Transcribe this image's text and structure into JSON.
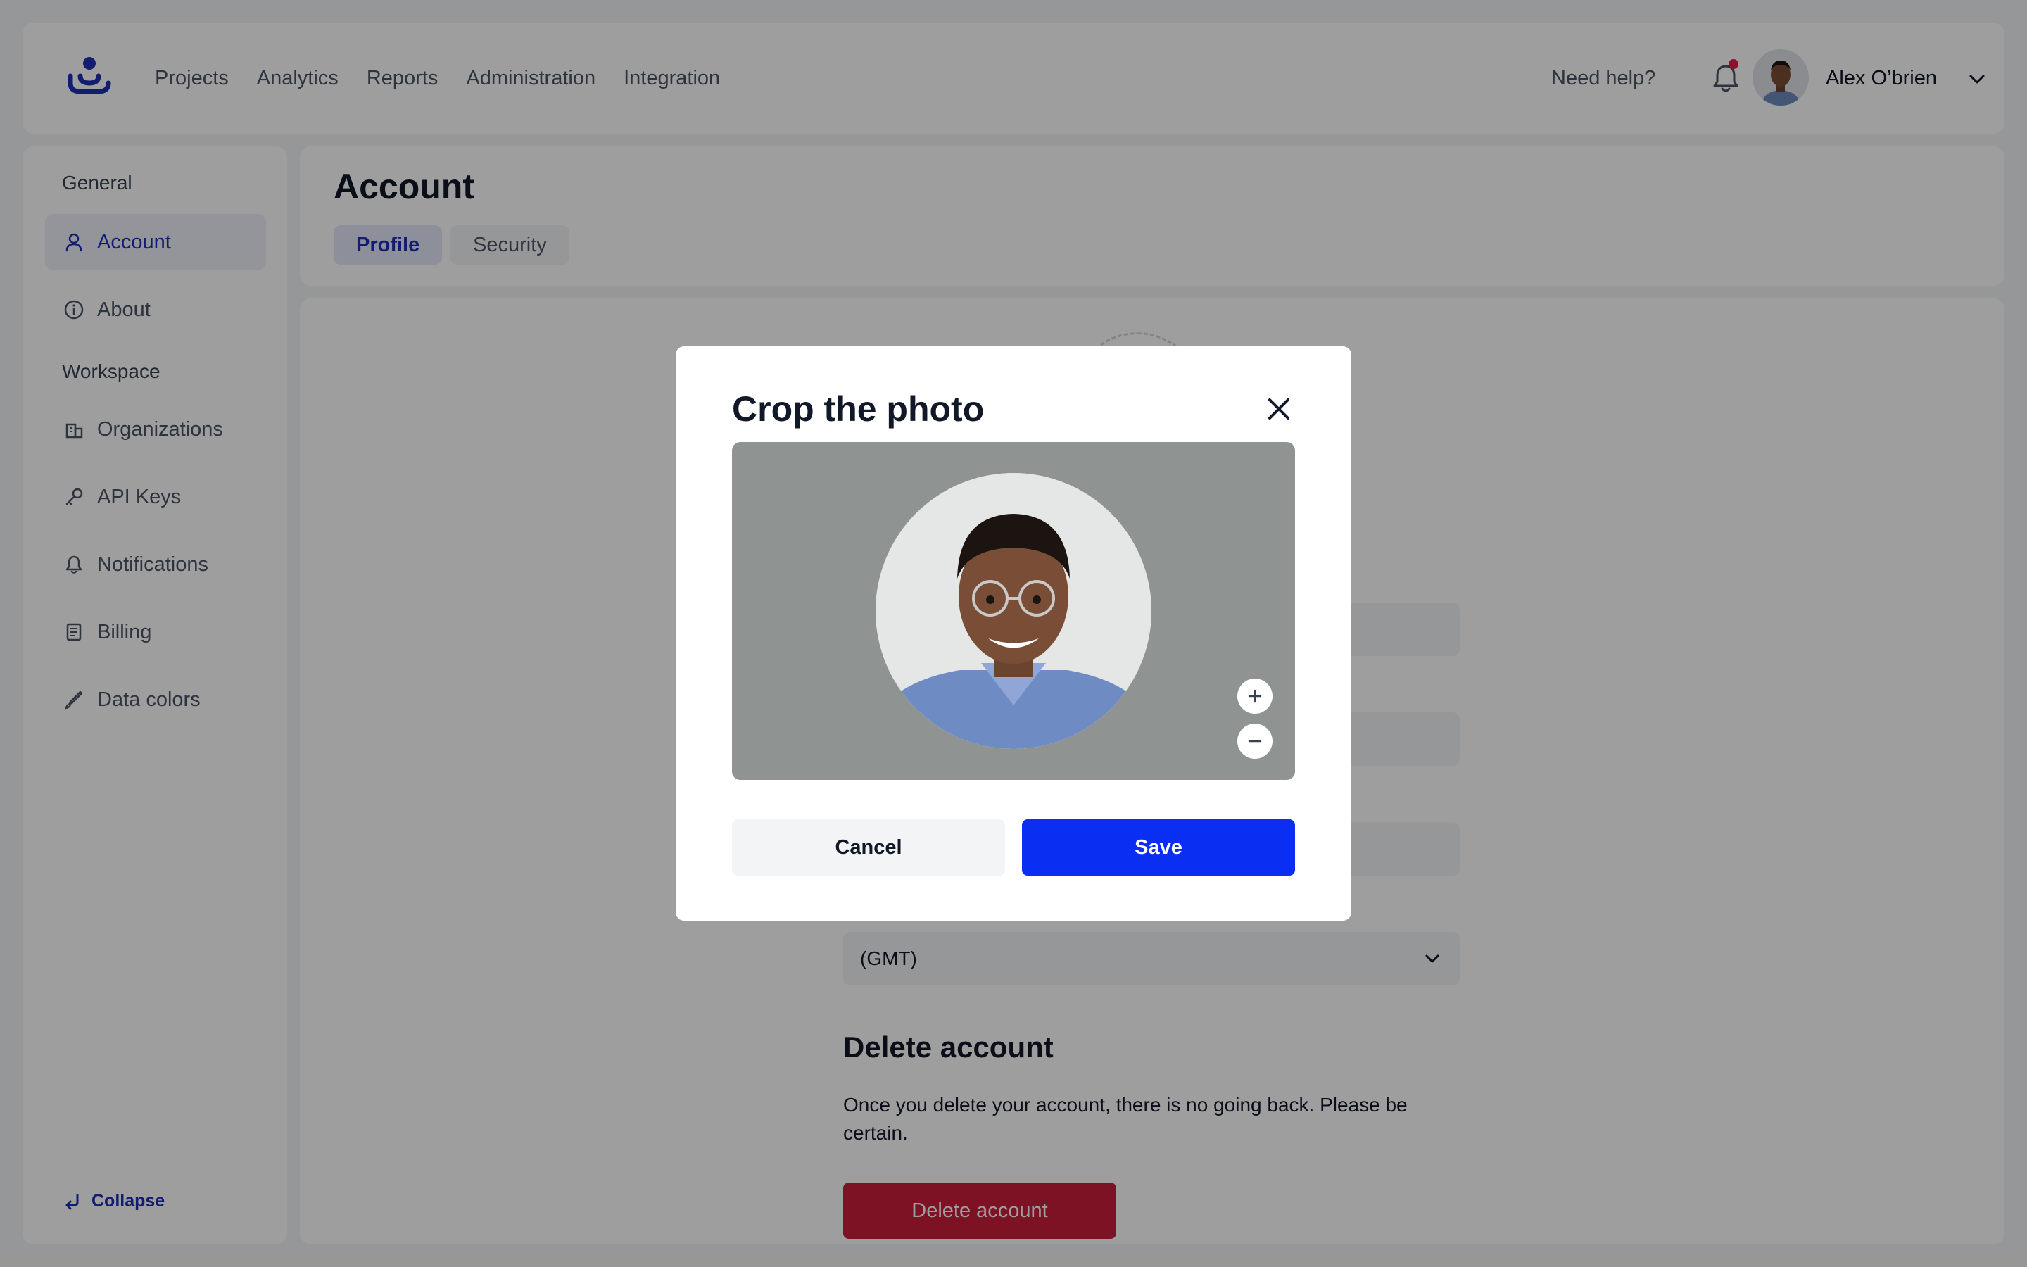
{
  "topnav": {
    "logo": "app-logo",
    "links": [
      "Projects",
      "Analytics",
      "Reports",
      "Administration",
      "Integration"
    ],
    "help": "Need help?",
    "user_name": "Alex O’brien",
    "notification_dot_color": "#e11d48"
  },
  "sidebar": {
    "general_label": "General",
    "workspace_label": "Workspace",
    "items": [
      {
        "label": "Account",
        "icon": "user-icon",
        "active": true
      },
      {
        "label": "About",
        "icon": "info-icon"
      },
      {
        "label": "Organizations",
        "icon": "building-icon"
      },
      {
        "label": "API Keys",
        "icon": "key-icon"
      },
      {
        "label": "Notifications",
        "icon": "bell-icon"
      },
      {
        "label": "Billing",
        "icon": "document-icon"
      },
      {
        "label": "Data colors",
        "icon": "brush-icon"
      }
    ],
    "collapse_label": "Collapse"
  },
  "account": {
    "title": "Account",
    "tabs": [
      {
        "label": "Profile",
        "active": true
      },
      {
        "label": "Security"
      }
    ]
  },
  "profile": {
    "timezone_value": "(GMT)",
    "delete_title": "Delete account",
    "delete_text": "Once you delete your account, there is no going back. Please be certain.",
    "delete_button": "Delete account",
    "delete_color": "#c81e3a"
  },
  "modal": {
    "title": "Crop the photo",
    "cancel_label": "Cancel",
    "save_label": "Save",
    "save_color": "#0a2ef2"
  }
}
